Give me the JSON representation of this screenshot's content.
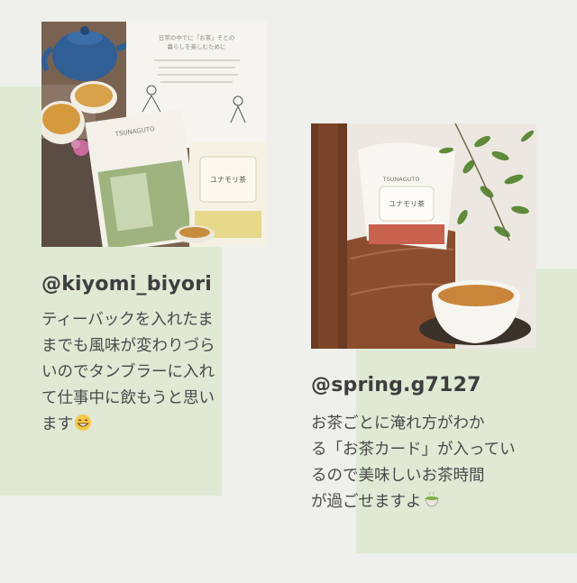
{
  "posts": [
    {
      "handle": "@kiyomi_biyori",
      "comment_lines": [
        "ティーバックを入れたま",
        "までも風味が変わりづら",
        "いのでタンブラーに入れ",
        "て仕事中に飲もうと思い",
        "ます"
      ],
      "emoji": "grinning-face-icon"
    },
    {
      "handle": "@spring.g7127",
      "comment_lines": [
        "お茶ごとに淹れ方がわか",
        "る「お茶カード」が入ってい",
        "るので美味しいお茶時間",
        "が過ごせますよ"
      ],
      "emoji": "teacup-icon"
    }
  ],
  "photo_1": {
    "brand_label": "TSUNAGUTO",
    "card_text_lines": [
      "日常の中でに「お茶」そとの",
      "暮らしを楽しむために"
    ],
    "pouch_label": "ユナモリ茶"
  },
  "photo_2": {
    "brand_label": "TSUNAGUTO",
    "pouch_label": "ユナモリ茶"
  },
  "colors": {
    "background": "#efefeb",
    "green_block": "#dfe9d4"
  }
}
